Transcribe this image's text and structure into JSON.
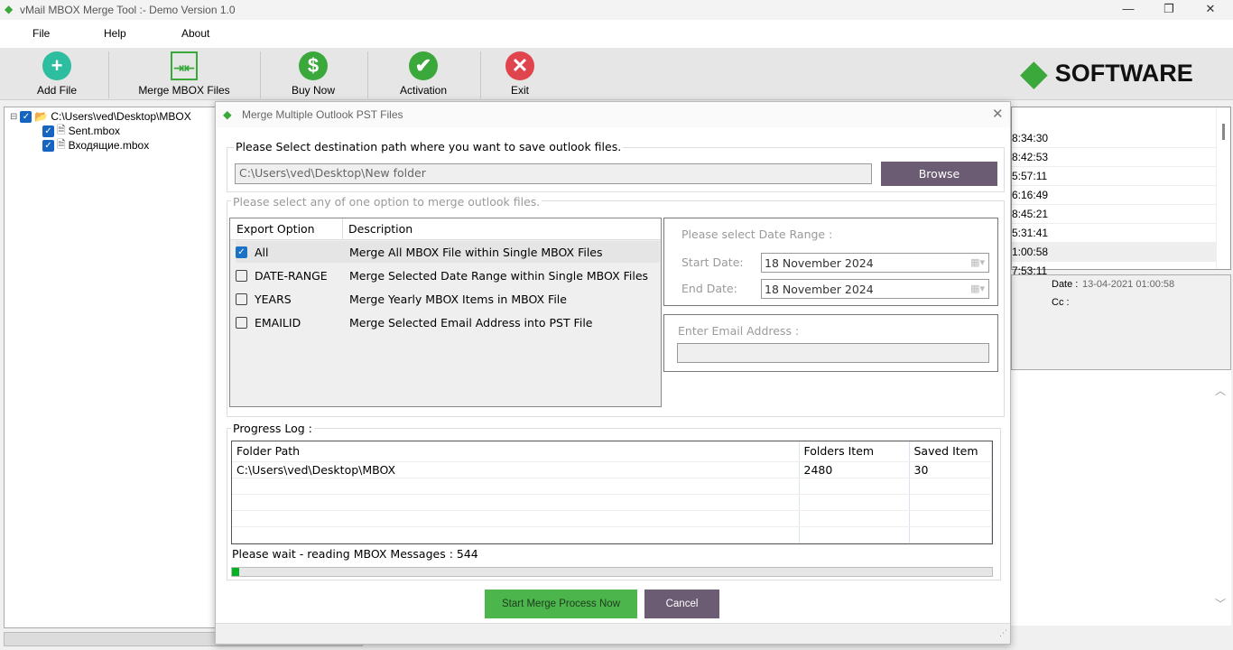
{
  "window": {
    "title": "vMail MBOX Merge Tool  :- Demo Version 1.0",
    "minimize": "—",
    "restore": "❐",
    "close": "✕"
  },
  "menu": [
    "File",
    "Help",
    "About"
  ],
  "toolbar": {
    "buttons": [
      {
        "label": "Add File",
        "icon": "plus-circle-icon",
        "color": "#2dbd9f"
      },
      {
        "label": "Merge MBOX Files",
        "icon": "merge-icon",
        "color": "#3aa83a"
      },
      {
        "label": "Buy Now",
        "icon": "dollar-circle-icon",
        "color": "#3aa83a"
      },
      {
        "label": "Activation",
        "icon": "check-circle-icon",
        "color": "#3aa83a"
      },
      {
        "label": "Exit",
        "icon": "close-circle-icon",
        "color": "#e0454f"
      }
    ],
    "logo_text": "SOFTWARE"
  },
  "tree": {
    "root": "C:\\Users\\ved\\Desktop\\MBOX",
    "children": [
      "Sent.mbox",
      "Входящие.mbox"
    ]
  },
  "right_list": {
    "times": [
      "8:34:30",
      "8:42:53",
      "5:57:11",
      "6:16:49",
      "8:45:21",
      "5:31:41",
      "1:00:58",
      "7:53:11"
    ]
  },
  "details": {
    "date_label": "Date :",
    "date_value": "13-04-2021 01:00:58",
    "cc_label": "Cc :"
  },
  "dialog": {
    "title": "Merge Multiple Outlook PST Files",
    "dest_label": "Please Select destination path where you want to save outlook files.",
    "dest_path": "C:\\Users\\ved\\Desktop\\New folder",
    "browse": "Browse",
    "option_label": "Please select any of one option to merge outlook files.",
    "option_headers": [
      "Export Option",
      "Description"
    ],
    "options": [
      {
        "name": "All",
        "desc": "Merge All MBOX File within Single MBOX Files",
        "checked": true
      },
      {
        "name": "DATE-RANGE",
        "desc": "Merge Selected Date Range within Single MBOX Files",
        "checked": false
      },
      {
        "name": "YEARS",
        "desc": "Merge Yearly MBOX Items in MBOX File",
        "checked": false
      },
      {
        "name": "EMAILID",
        "desc": "Merge Selected Email Address into PST File",
        "checked": false
      }
    ],
    "date_range_label": "Please select Date Range :",
    "start_label": "Start Date:",
    "start_value": "18  November  2024",
    "end_label": "End Date:",
    "end_value": "18  November  2024",
    "email_label": "Enter Email Address :",
    "email_value": "",
    "progress_label": "Progress Log :",
    "log_headers": [
      "Folder Path",
      "Folders Item",
      "Saved Item"
    ],
    "log_rows": [
      [
        "C:\\Users\\ved\\Desktop\\MBOX",
        "2480",
        "30"
      ]
    ],
    "status": "Please wait - reading MBOX Messages : 544",
    "progress_percent": 1,
    "start_button": "Start Merge Process Now",
    "cancel_button": "Cancel",
    "colors": {
      "start": "#4cb64c",
      "cancel": "#6b5b73",
      "browse": "#6b5b73",
      "progress": "#06b025"
    }
  }
}
